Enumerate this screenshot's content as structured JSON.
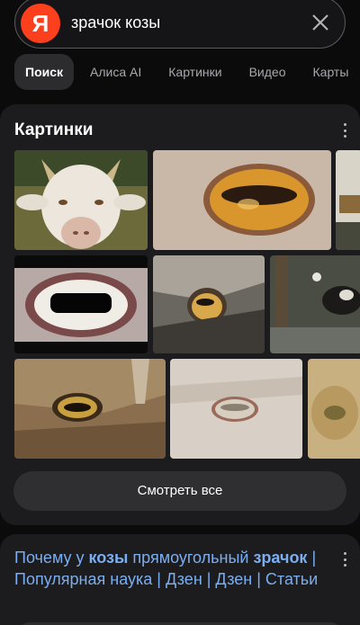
{
  "search": {
    "logo_letter": "Я",
    "query": "зрачок козы"
  },
  "tabs": [
    {
      "label": "Поиск",
      "active": true
    },
    {
      "label": "Алиса AI",
      "active": false
    },
    {
      "label": "Картинки",
      "active": false
    },
    {
      "label": "Видео",
      "active": false
    },
    {
      "label": "Карты",
      "active": false
    }
  ],
  "images_block": {
    "title": "Картинки",
    "see_all_label": "Смотреть все"
  },
  "result": {
    "title_part1": "Почему у ",
    "title_bold1": "козы",
    "title_part2": " прямоугольный ",
    "title_bold2": "зрачок",
    "title_part3": " | Популярная наука | Дзен | Дзен | Статьи"
  },
  "colors": {
    "brand": "#fc3f1d",
    "link": "#7aaef0",
    "card": "#1c1c1e"
  }
}
